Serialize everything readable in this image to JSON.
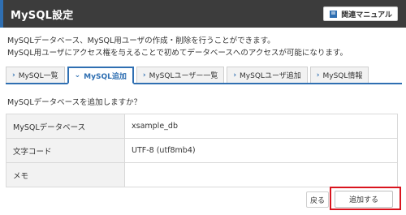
{
  "header": {
    "title": "MySQL設定",
    "manual_label": "関連マニュアル",
    "manual_icon": "book-icon",
    "accent_color": "#2f6fb2",
    "bar_color": "#3c3c3c"
  },
  "description": {
    "line1": "MySQLデータベース、MySQL用ユーザの作成・削除を行うことができます。",
    "line2": "MySQL用ユーザにアクセス権を与えることで初めてデータベースへのアクセスが可能になります。"
  },
  "tabs": [
    {
      "label": "MySQL一覧",
      "active": false
    },
    {
      "label": "MySQL追加",
      "active": true
    },
    {
      "label": "MySQLユーザー一覧",
      "active": false
    },
    {
      "label": "MySQLユーザ追加",
      "active": false
    },
    {
      "label": "MySQL情報",
      "active": false
    }
  ],
  "tab_icon": "chevron-right-icon",
  "confirm": {
    "question": "MySQLデータベースを追加しますか？",
    "rows": [
      {
        "label": "MySQLデータベース",
        "value": "xsample_db"
      },
      {
        "label": "文字コード",
        "value": "UTF-8 (utf8mb4)"
      },
      {
        "label": "メモ",
        "value": ""
      }
    ]
  },
  "buttons": {
    "back_label": "戻る",
    "add_label": "追加する",
    "highlight_color": "#d9141e"
  }
}
